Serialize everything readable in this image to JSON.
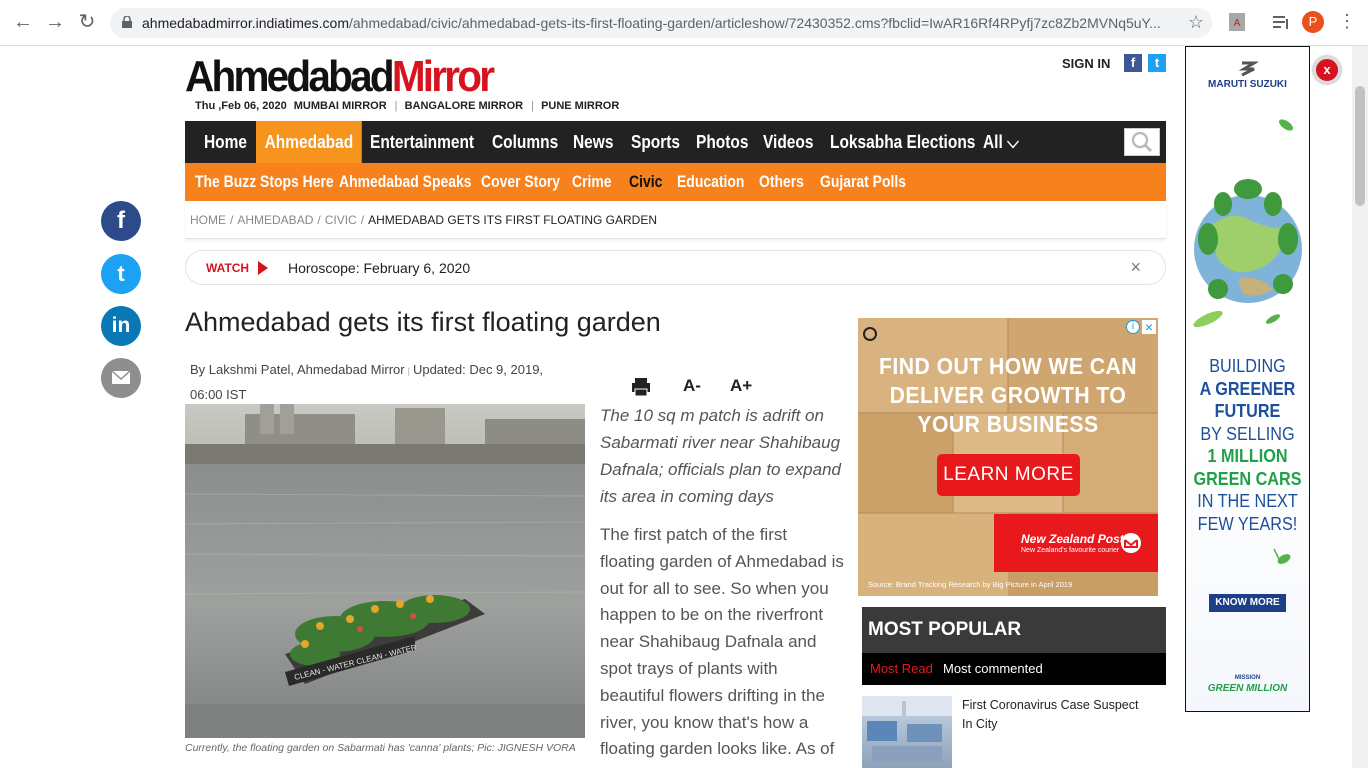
{
  "browser": {
    "url_host": "ahmedabadmirror.indiatimes.com",
    "url_path": "/ahmedabad/civic/ahmedabad-gets-its-first-floating-garden/articleshow/72430352.cms?fbclid=IwAR16Rf4RPyfj7zc8Zb2MVNq5uY...",
    "profile_initial": "P",
    "icons": [
      "back-icon",
      "forward-icon",
      "reload-icon",
      "lock-icon",
      "star-icon",
      "pdf-extension-icon",
      "reading-list-icon",
      "kebab-menu-icon"
    ]
  },
  "header": {
    "logo_part1": "Ahmedabad",
    "logo_part2": "Mirror",
    "date": "Thu ,Feb 06, 2020",
    "editions": [
      "MUMBAI MIRROR",
      "BANGALORE MIRROR",
      "PUNE MIRROR"
    ],
    "signin": "SIGN IN",
    "fb": "f",
    "tw": "t"
  },
  "main_nav": [
    "Home",
    "Ahmedabad",
    "Entertainment",
    "Columns",
    "News",
    "Sports",
    "Photos",
    "Videos",
    "Loksabha Elections",
    "All"
  ],
  "sub_nav": [
    "The Buzz Stops Here",
    "Ahmedabad Speaks",
    "Cover Story",
    "Crime",
    "Civic",
    "Education",
    "Others",
    "Gujarat Polls"
  ],
  "breadcrumb": [
    "HOME",
    "AHMEDABAD",
    "CIVIC",
    "AHMEDABAD GETS ITS FIRST FLOATING GARDEN"
  ],
  "watch": {
    "label": "WATCH",
    "text": "Horoscope: February 6, 2020",
    "close": "×"
  },
  "article": {
    "headline": "Ahmedabad gets its first floating garden",
    "byline_author": "By Lakshmi Patel, Ahmedabad Mirror",
    "byline_updated": "Updated: Dec 9, 2019, 06:00 IST",
    "tool_small": "A-",
    "tool_large": "A+",
    "summary": "The 10 sq m patch is adrift on Sabarmati river near Shahibaug Dafnala; officials plan to expand its area in coming days",
    "body": "The first patch of the first floating garden of Ahmedabad is out for all to see. So when you happen to be on the riverfront near Shahibaug Dafnala and spot trays of plants with beautiful flowers drifting in the river, you know that's how a floating garden looks like. As of",
    "caption": "Currently, the floating garden on Sabarmati has 'canna' plants; Pic: JIGNESH VORA",
    "photo_sign": "CLEAN - WATER  CLEAN - WATER"
  },
  "ad_nzpost": {
    "headline": "FIND OUT HOW WE CAN DELIVER GROWTH TO YOUR BUSINESS",
    "button": "LEARN MORE",
    "brand": "New Zealand Post",
    "tagline": "New Zealand's favourite courier",
    "source": "Source: Brand Tracking Research by Big Picture in April 2019",
    "info": "i",
    "close": "×"
  },
  "most_popular": {
    "title": "MOST POPULAR",
    "tabs": [
      "Most Read",
      "Most commented"
    ],
    "item": "First Coronavirus Case Suspect In City"
  },
  "ad_maruti": {
    "brand": "MARUTI SUZUKI",
    "line1": "BUILDING",
    "line2": "A GREENER",
    "line3": "FUTURE",
    "line4": "BY SELLING",
    "line5": "1 MILLION",
    "line6": "GREEN CARS",
    "line7": "IN THE NEXT",
    "line8": "FEW YEARS!",
    "button": "KNOW MORE",
    "mission_small": "MISSION",
    "mission": "GREEN MILLION",
    "close": "x"
  },
  "social": [
    "f",
    "t",
    "in",
    "mail"
  ],
  "colors": {
    "accent": "#f7941d",
    "subnav": "#f7811d",
    "brand_red": "#d6141f",
    "nav_bg": "#222222"
  }
}
